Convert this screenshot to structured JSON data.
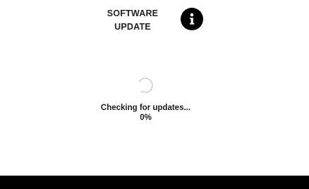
{
  "header": {
    "title_line1": "SOFTWARE",
    "title_line2": "UPDATE",
    "info_icon": "info-icon"
  },
  "status": {
    "spinner_icon": "loading-spinner-icon",
    "message": "Checking for updates...",
    "progress_text": "0%",
    "progress_fraction": 0
  },
  "colors": {
    "background": "#ffffff",
    "text": "#1a1a1a",
    "info_button": "#000000",
    "bottom_bar": "#000000"
  }
}
